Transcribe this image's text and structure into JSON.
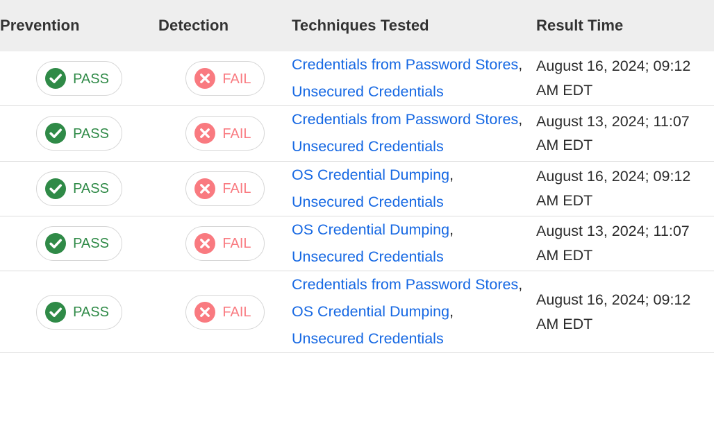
{
  "table": {
    "columns": [
      {
        "key": "prevention",
        "label": "Prevention"
      },
      {
        "key": "detection",
        "label": "Detection"
      },
      {
        "key": "techniques",
        "label": "Techniques Tested"
      },
      {
        "key": "result_time",
        "label": "Result Time"
      }
    ],
    "status_labels": {
      "pass": "PASS",
      "fail": "FAIL"
    },
    "icons": {
      "pass": "check-circle-icon",
      "fail": "x-circle-icon"
    },
    "colors": {
      "pass_green": "#2f8a47",
      "fail_red": "#f97a80",
      "link_blue": "#1668e3",
      "header_bg": "#eeeeee",
      "header_text": "#333333",
      "row_border": "#dcdcdc",
      "body_text": "#2b2b2b"
    },
    "rows": [
      {
        "prevention": "PASS",
        "detection": "FAIL",
        "techniques": [
          "Credentials from Password Stores",
          "Unsecured Credentials"
        ],
        "result_time": "August 16, 2024; 09:12 AM EDT"
      },
      {
        "prevention": "PASS",
        "detection": "FAIL",
        "techniques": [
          "Credentials from Password Stores",
          "Unsecured Credentials"
        ],
        "result_time": "August 13, 2024; 11:07 AM EDT"
      },
      {
        "prevention": "PASS",
        "detection": "FAIL",
        "techniques": [
          "OS Credential Dumping",
          "Unsecured Credentials"
        ],
        "result_time": "August 16, 2024; 09:12 AM EDT"
      },
      {
        "prevention": "PASS",
        "detection": "FAIL",
        "techniques": [
          "OS Credential Dumping",
          "Unsecured Credentials"
        ],
        "result_time": "August 13, 2024; 11:07 AM EDT"
      },
      {
        "prevention": "PASS",
        "detection": "FAIL",
        "techniques": [
          "Credentials from Password Stores",
          "OS Credential Dumping",
          "Unsecured Credentials"
        ],
        "result_time": "August 16, 2024; 09:12 AM EDT"
      }
    ]
  }
}
